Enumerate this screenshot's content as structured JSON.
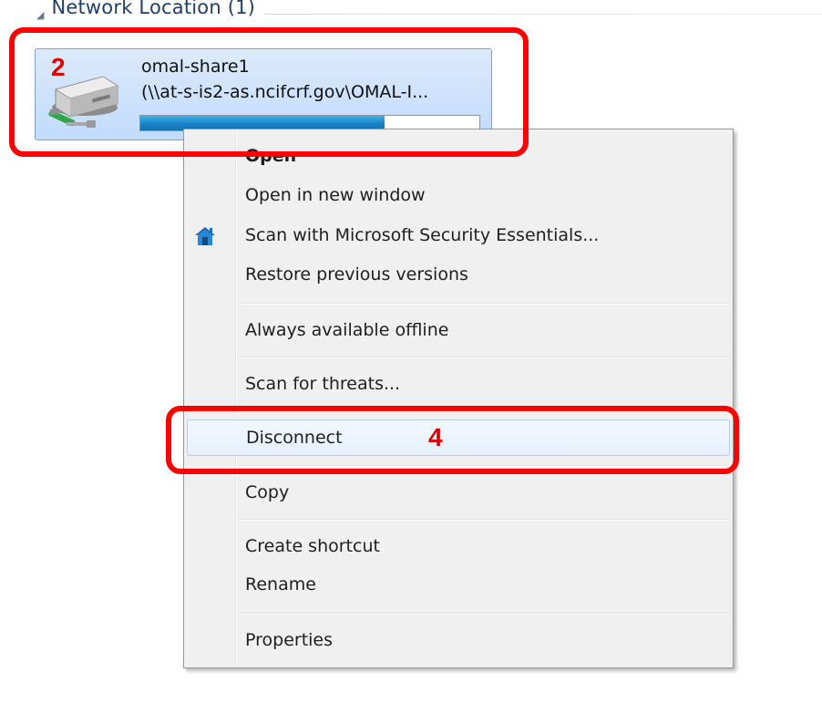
{
  "group": {
    "title": "Network Location (1)"
  },
  "drive": {
    "name": "omal-share1",
    "path": "(\\\\at-s-is2-as.ncifcrf.gov\\OMAL-I...",
    "usage_fraction": 0.72,
    "icon": "network-drive-icon"
  },
  "menu": {
    "items": [
      {
        "label": "Open"
      },
      {
        "label": "Open in new window"
      },
      {
        "label": "Scan with Microsoft Security Essentials...",
        "icon": "security-essentials-icon"
      },
      {
        "label": "Restore previous versions"
      },
      {
        "label": "Always available offline"
      },
      {
        "label": "Scan for threats..."
      },
      {
        "label": "Disconnect"
      },
      {
        "label": "Copy"
      },
      {
        "label": "Create shortcut"
      },
      {
        "label": "Rename"
      },
      {
        "label": "Properties"
      }
    ]
  },
  "annotations": {
    "step_drive": "2",
    "step_disconnect": "4",
    "color": "#ff0000"
  }
}
